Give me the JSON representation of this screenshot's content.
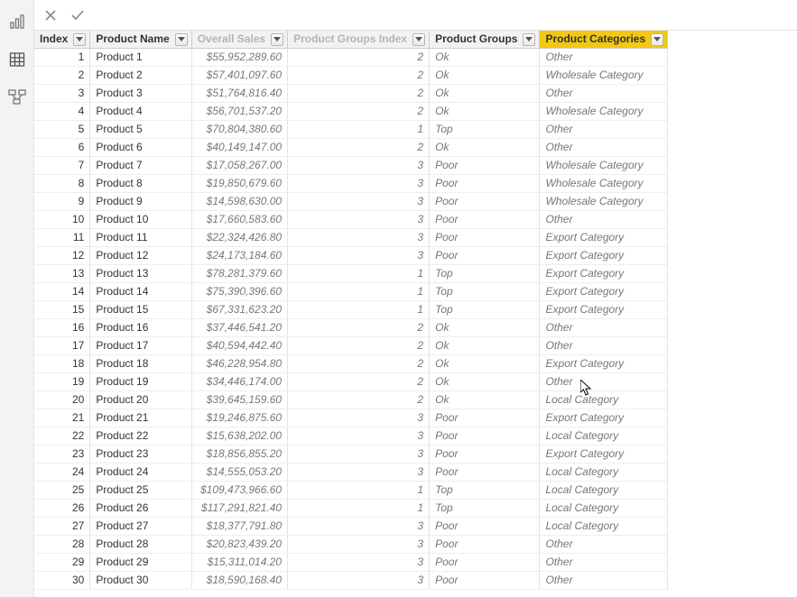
{
  "rail": {
    "report": "report-view",
    "data": "data-view",
    "model": "model-view"
  },
  "formula_bar": {
    "cancel_title": "Cancel",
    "commit_title": "Commit",
    "value": ""
  },
  "columns": [
    {
      "key": "index",
      "label": "Index",
      "inactive": false,
      "selected": false
    },
    {
      "key": "product_name",
      "label": "Product Name",
      "inactive": false,
      "selected": false
    },
    {
      "key": "overall_sales",
      "label": "Overall Sales",
      "inactive": true,
      "selected": false
    },
    {
      "key": "product_groups_index",
      "label": "Product Groups Index",
      "inactive": true,
      "selected": false
    },
    {
      "key": "product_groups",
      "label": "Product Groups",
      "inactive": false,
      "selected": false
    },
    {
      "key": "product_categories",
      "label": "Product Categories",
      "inactive": false,
      "selected": true
    }
  ],
  "chart_data": {
    "type": "table",
    "rows": [
      {
        "index": 1,
        "product_name": "Product 1",
        "overall_sales": "$55,952,289.60",
        "product_groups_index": 2,
        "product_groups": "Ok",
        "product_categories": "Other"
      },
      {
        "index": 2,
        "product_name": "Product 2",
        "overall_sales": "$57,401,097.60",
        "product_groups_index": 2,
        "product_groups": "Ok",
        "product_categories": "Wholesale Category"
      },
      {
        "index": 3,
        "product_name": "Product 3",
        "overall_sales": "$51,764,816.40",
        "product_groups_index": 2,
        "product_groups": "Ok",
        "product_categories": "Other"
      },
      {
        "index": 4,
        "product_name": "Product 4",
        "overall_sales": "$56,701,537.20",
        "product_groups_index": 2,
        "product_groups": "Ok",
        "product_categories": "Wholesale Category"
      },
      {
        "index": 5,
        "product_name": "Product 5",
        "overall_sales": "$70,804,380.60",
        "product_groups_index": 1,
        "product_groups": "Top",
        "product_categories": "Other"
      },
      {
        "index": 6,
        "product_name": "Product 6",
        "overall_sales": "$40,149,147.00",
        "product_groups_index": 2,
        "product_groups": "Ok",
        "product_categories": "Other"
      },
      {
        "index": 7,
        "product_name": "Product 7",
        "overall_sales": "$17,058,267.00",
        "product_groups_index": 3,
        "product_groups": "Poor",
        "product_categories": "Wholesale Category"
      },
      {
        "index": 8,
        "product_name": "Product 8",
        "overall_sales": "$19,850,679.60",
        "product_groups_index": 3,
        "product_groups": "Poor",
        "product_categories": "Wholesale Category"
      },
      {
        "index": 9,
        "product_name": "Product 9",
        "overall_sales": "$14,598,630.00",
        "product_groups_index": 3,
        "product_groups": "Poor",
        "product_categories": "Wholesale Category"
      },
      {
        "index": 10,
        "product_name": "Product 10",
        "overall_sales": "$17,660,583.60",
        "product_groups_index": 3,
        "product_groups": "Poor",
        "product_categories": "Other"
      },
      {
        "index": 11,
        "product_name": "Product 11",
        "overall_sales": "$22,324,426.80",
        "product_groups_index": 3,
        "product_groups": "Poor",
        "product_categories": "Export Category"
      },
      {
        "index": 12,
        "product_name": "Product 12",
        "overall_sales": "$24,173,184.60",
        "product_groups_index": 3,
        "product_groups": "Poor",
        "product_categories": "Export Category"
      },
      {
        "index": 13,
        "product_name": "Product 13",
        "overall_sales": "$78,281,379.60",
        "product_groups_index": 1,
        "product_groups": "Top",
        "product_categories": "Export Category"
      },
      {
        "index": 14,
        "product_name": "Product 14",
        "overall_sales": "$75,390,396.60",
        "product_groups_index": 1,
        "product_groups": "Top",
        "product_categories": "Export Category"
      },
      {
        "index": 15,
        "product_name": "Product 15",
        "overall_sales": "$67,331,623.20",
        "product_groups_index": 1,
        "product_groups": "Top",
        "product_categories": "Export Category"
      },
      {
        "index": 16,
        "product_name": "Product 16",
        "overall_sales": "$37,446,541.20",
        "product_groups_index": 2,
        "product_groups": "Ok",
        "product_categories": "Other"
      },
      {
        "index": 17,
        "product_name": "Product 17",
        "overall_sales": "$40,594,442.40",
        "product_groups_index": 2,
        "product_groups": "Ok",
        "product_categories": "Other"
      },
      {
        "index": 18,
        "product_name": "Product 18",
        "overall_sales": "$46,228,954.80",
        "product_groups_index": 2,
        "product_groups": "Ok",
        "product_categories": "Export Category"
      },
      {
        "index": 19,
        "product_name": "Product 19",
        "overall_sales": "$34,446,174.00",
        "product_groups_index": 2,
        "product_groups": "Ok",
        "product_categories": "Other"
      },
      {
        "index": 20,
        "product_name": "Product 20",
        "overall_sales": "$39,645,159.60",
        "product_groups_index": 2,
        "product_groups": "Ok",
        "product_categories": "Local Category"
      },
      {
        "index": 21,
        "product_name": "Product 21",
        "overall_sales": "$19,246,875.60",
        "product_groups_index": 3,
        "product_groups": "Poor",
        "product_categories": "Export Category"
      },
      {
        "index": 22,
        "product_name": "Product 22",
        "overall_sales": "$15,638,202.00",
        "product_groups_index": 3,
        "product_groups": "Poor",
        "product_categories": "Local Category"
      },
      {
        "index": 23,
        "product_name": "Product 23",
        "overall_sales": "$18,856,855.20",
        "product_groups_index": 3,
        "product_groups": "Poor",
        "product_categories": "Export Category"
      },
      {
        "index": 24,
        "product_name": "Product 24",
        "overall_sales": "$14,555,053.20",
        "product_groups_index": 3,
        "product_groups": "Poor",
        "product_categories": "Local Category"
      },
      {
        "index": 25,
        "product_name": "Product 25",
        "overall_sales": "$109,473,966.60",
        "product_groups_index": 1,
        "product_groups": "Top",
        "product_categories": "Local Category"
      },
      {
        "index": 26,
        "product_name": "Product 26",
        "overall_sales": "$117,291,821.40",
        "product_groups_index": 1,
        "product_groups": "Top",
        "product_categories": "Local Category"
      },
      {
        "index": 27,
        "product_name": "Product 27",
        "overall_sales": "$18,377,791.80",
        "product_groups_index": 3,
        "product_groups": "Poor",
        "product_categories": "Local Category"
      },
      {
        "index": 28,
        "product_name": "Product 28",
        "overall_sales": "$20,823,439.20",
        "product_groups_index": 3,
        "product_groups": "Poor",
        "product_categories": "Other"
      },
      {
        "index": 29,
        "product_name": "Product 29",
        "overall_sales": "$15,311,014.20",
        "product_groups_index": 3,
        "product_groups": "Poor",
        "product_categories": "Other"
      },
      {
        "index": 30,
        "product_name": "Product 30",
        "overall_sales": "$18,590,168.40",
        "product_groups_index": 3,
        "product_groups": "Poor",
        "product_categories": "Other"
      }
    ]
  }
}
